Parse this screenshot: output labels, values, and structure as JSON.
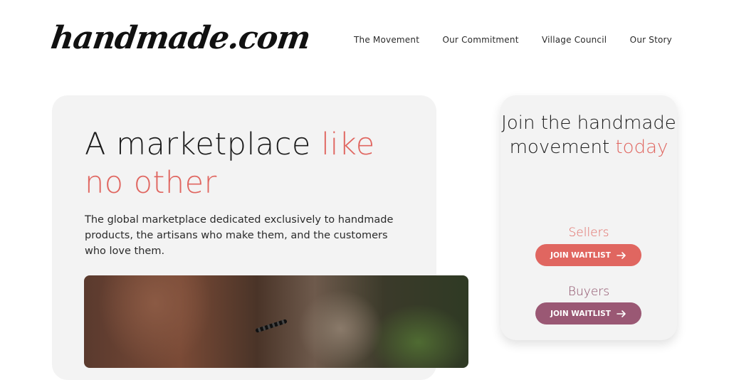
{
  "header": {
    "logo": "handmade.com",
    "nav": [
      "The Movement",
      "Our Commitment",
      "Village Council",
      "Our Story"
    ]
  },
  "hero": {
    "title_plain": "A marketplace ",
    "title_accent": "like no other",
    "description": "The global marketplace dedicated exclusively to handmade products, the artisans who make them, and the customers who love them."
  },
  "waitlist": {
    "title_plain": "Join the handmade movement ",
    "title_accent": "today",
    "sellers_label": "Sellers",
    "buyers_label": "Buyers",
    "button_label": "JOIN WAITLIST",
    "arrow_icon": "arrow-right-icon"
  },
  "colors": {
    "accent": "#e06660",
    "buyer_accent": "#9a5874",
    "card_background": "#f3f3f3"
  }
}
